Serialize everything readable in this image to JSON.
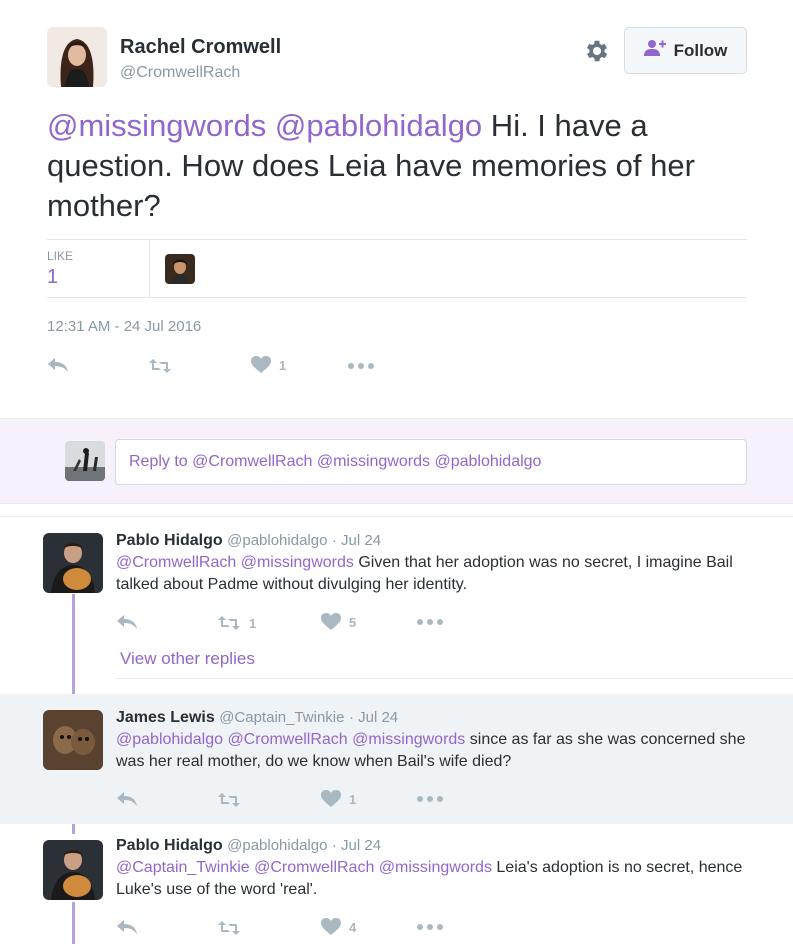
{
  "main_tweet": {
    "author_name": "Rachel Cromwell",
    "author_handle": "@CromwellRach",
    "follow_label": "Follow",
    "mention1": "@missingwords",
    "mention2": "@pablohidalgo",
    "text": " Hi. I have a question. How does Leia have memories of her mother?",
    "like_label": "LIKE",
    "like_count": "1",
    "timestamp": "12:31 AM - 24 Jul 2016",
    "actions": {
      "like_count": "1"
    }
  },
  "reply_box": {
    "placeholder": "Reply to @CromwellRach @missingwords @pablohidalgo"
  },
  "replies": [
    {
      "name": "Pablo Hidalgo",
      "handle": "@pablohidalgo",
      "date": "· Jul 24",
      "mentions": "@CromwellRach @missingwords",
      "text": " Given that her adoption was no secret, I imagine Bail talked about Padme without divulging her identity.",
      "retweets": "1",
      "likes": "5",
      "view_other": "View other replies"
    },
    {
      "name": "James Lewis",
      "handle": "@Captain_Twinkie",
      "date": "· Jul 24",
      "mentions": "@pablohidalgo @CromwellRach @missingwords",
      "text": " since as far as she was concerned she was her real mother, do we know when Bail's wife died?",
      "retweets": "",
      "likes": "1"
    },
    {
      "name": "Pablo Hidalgo",
      "handle": "@pablohidalgo",
      "date": "· Jul 24",
      "mentions": "@Captain_Twinkie @CromwellRach @missingwords",
      "text": " Leia's adoption is no secret, hence Luke's use of the word 'real'.",
      "retweets": "",
      "likes": "4"
    }
  ],
  "icons": {
    "reply": "reply-icon",
    "retweet": "retweet-icon",
    "like": "heart-icon",
    "more": "more-icon",
    "settings": "gear-icon",
    "follow": "add-user-icon"
  },
  "colors": {
    "accent": "#9266cc",
    "thread_line": "#b9a0e0",
    "muted": "#8899a6",
    "action_icon": "#aab8c2"
  }
}
